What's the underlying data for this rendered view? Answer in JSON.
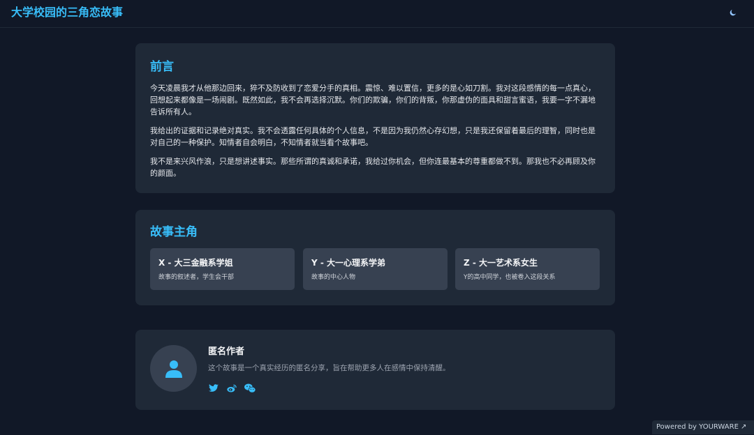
{
  "header": {
    "title": "大学校园的三角恋故事",
    "theme_icon": "moon-icon"
  },
  "preface": {
    "heading": "前言",
    "paragraphs": [
      "今天凌晨我才从他那边回来，猝不及防收到了恋爱分手的真相。震惊、难以置信，更多的是心如刀割。我对这段感情的每一点真心，回想起来都像是一场闹剧。既然如此，我不会再选择沉默。你们的欺骗，你们的背叛，你那虚伪的面具和甜言蜜语，我要一字不漏地告诉所有人。",
      "我给出的证据和记录绝对真实。我不会透露任何具体的个人信息，不是因为我仍然心存幻想，只是我还保留着最后的理智，同时也是对自己的一种保护。知情者自会明白，不知情者就当看个故事吧。",
      "我不是来兴风作浪，只是想讲述事实。那些所谓的真诚和承诺，我给过你机会，但你连最基本的尊重都做不到。那我也不必再顾及你的颜面。"
    ]
  },
  "characters": {
    "heading": "故事主角",
    "items": [
      {
        "name": "X - 大三金融系学姐",
        "desc": "故事的叙述者，学生会干部"
      },
      {
        "name": "Y - 大一心理系学弟",
        "desc": "故事的中心人物"
      },
      {
        "name": "Z - 大一艺术系女生",
        "desc": "Y的高中同学，也被卷入这段关系"
      }
    ]
  },
  "author": {
    "name": "匿名作者",
    "bio": "这个故事是一个真实经历的匿名分享，旨在帮助更多人在感情中保持清醒。",
    "avatar_icon": "user-icon",
    "socials": [
      "twitter-icon",
      "weibo-icon",
      "wechat-icon"
    ]
  },
  "footer": {
    "powered": "Powered by YOURWARE ↗"
  },
  "colors": {
    "accent": "#38bdf8",
    "background": "#111827",
    "card": "#1f2937",
    "subcard": "#374151"
  }
}
